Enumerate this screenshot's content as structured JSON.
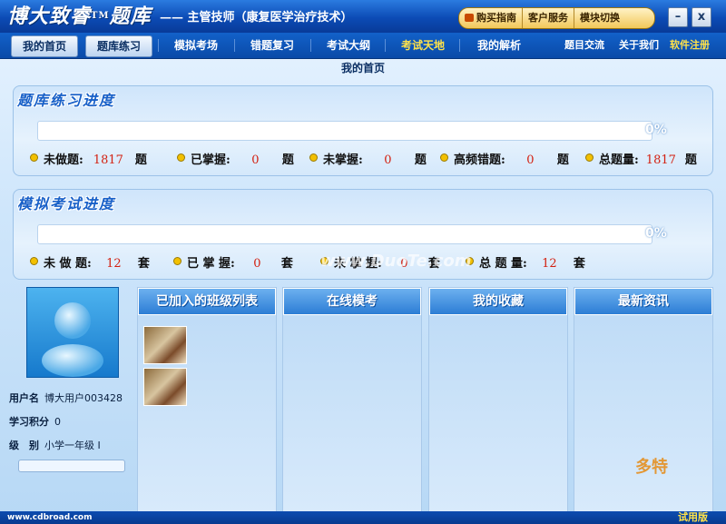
{
  "app": {
    "brand": "博大致睿",
    "brand_tm": "TM",
    "brand_suffix": "题库",
    "subtitle": "—— 主管技师（康复医学治疗技术）"
  },
  "top_buttons": [
    "购买指南",
    "客户服务",
    "模块切换"
  ],
  "window": {
    "minimize": "–",
    "close": "x"
  },
  "nav": {
    "items": [
      "我的首页",
      "题库练习",
      "模拟考场",
      "错题复习",
      "考试大纲",
      "考试天地",
      "我的解析"
    ],
    "right": [
      "题目交流",
      "关于我们",
      "软件注册"
    ]
  },
  "page_title": "我的首页",
  "practice": {
    "title": "题库练习进度",
    "percent": "0%",
    "progress": 0,
    "stats": [
      {
        "label": "未做题:",
        "value": "1817",
        "unit": "题"
      },
      {
        "label": "已掌握:",
        "value": "0",
        "unit": "题"
      },
      {
        "label": "未掌握:",
        "value": "0",
        "unit": "题"
      },
      {
        "label": "高频错题:",
        "value": "0",
        "unit": "题"
      },
      {
        "label": "总题量:",
        "value": "1817",
        "unit": "题"
      }
    ]
  },
  "exam": {
    "title": "模拟考试进度",
    "percent": "0%",
    "progress": 0,
    "stats": [
      {
        "label": "未 做 题:",
        "value": "12",
        "unit": "套"
      },
      {
        "label": "已 掌 握:",
        "value": "0",
        "unit": "套"
      },
      {
        "label": "未 掌 握:",
        "value": "0",
        "unit": "套"
      },
      {
        "label": "总 题 量:",
        "value": "12",
        "unit": "套"
      }
    ]
  },
  "user": {
    "name_label": "用户名",
    "name": "博大用户003428",
    "points_label": "学习积分",
    "points": "0",
    "level_label": "级　别",
    "level": "小学一年级 I"
  },
  "columns": [
    "已加入的班级列表",
    "在线模考",
    "我的收藏",
    "最新资讯"
  ],
  "footer": {
    "url": "www.cdbroad.com",
    "trial": "试用版"
  },
  "watermarks": {
    "corner": "多特",
    "middle": "www.DuoTe.com"
  }
}
